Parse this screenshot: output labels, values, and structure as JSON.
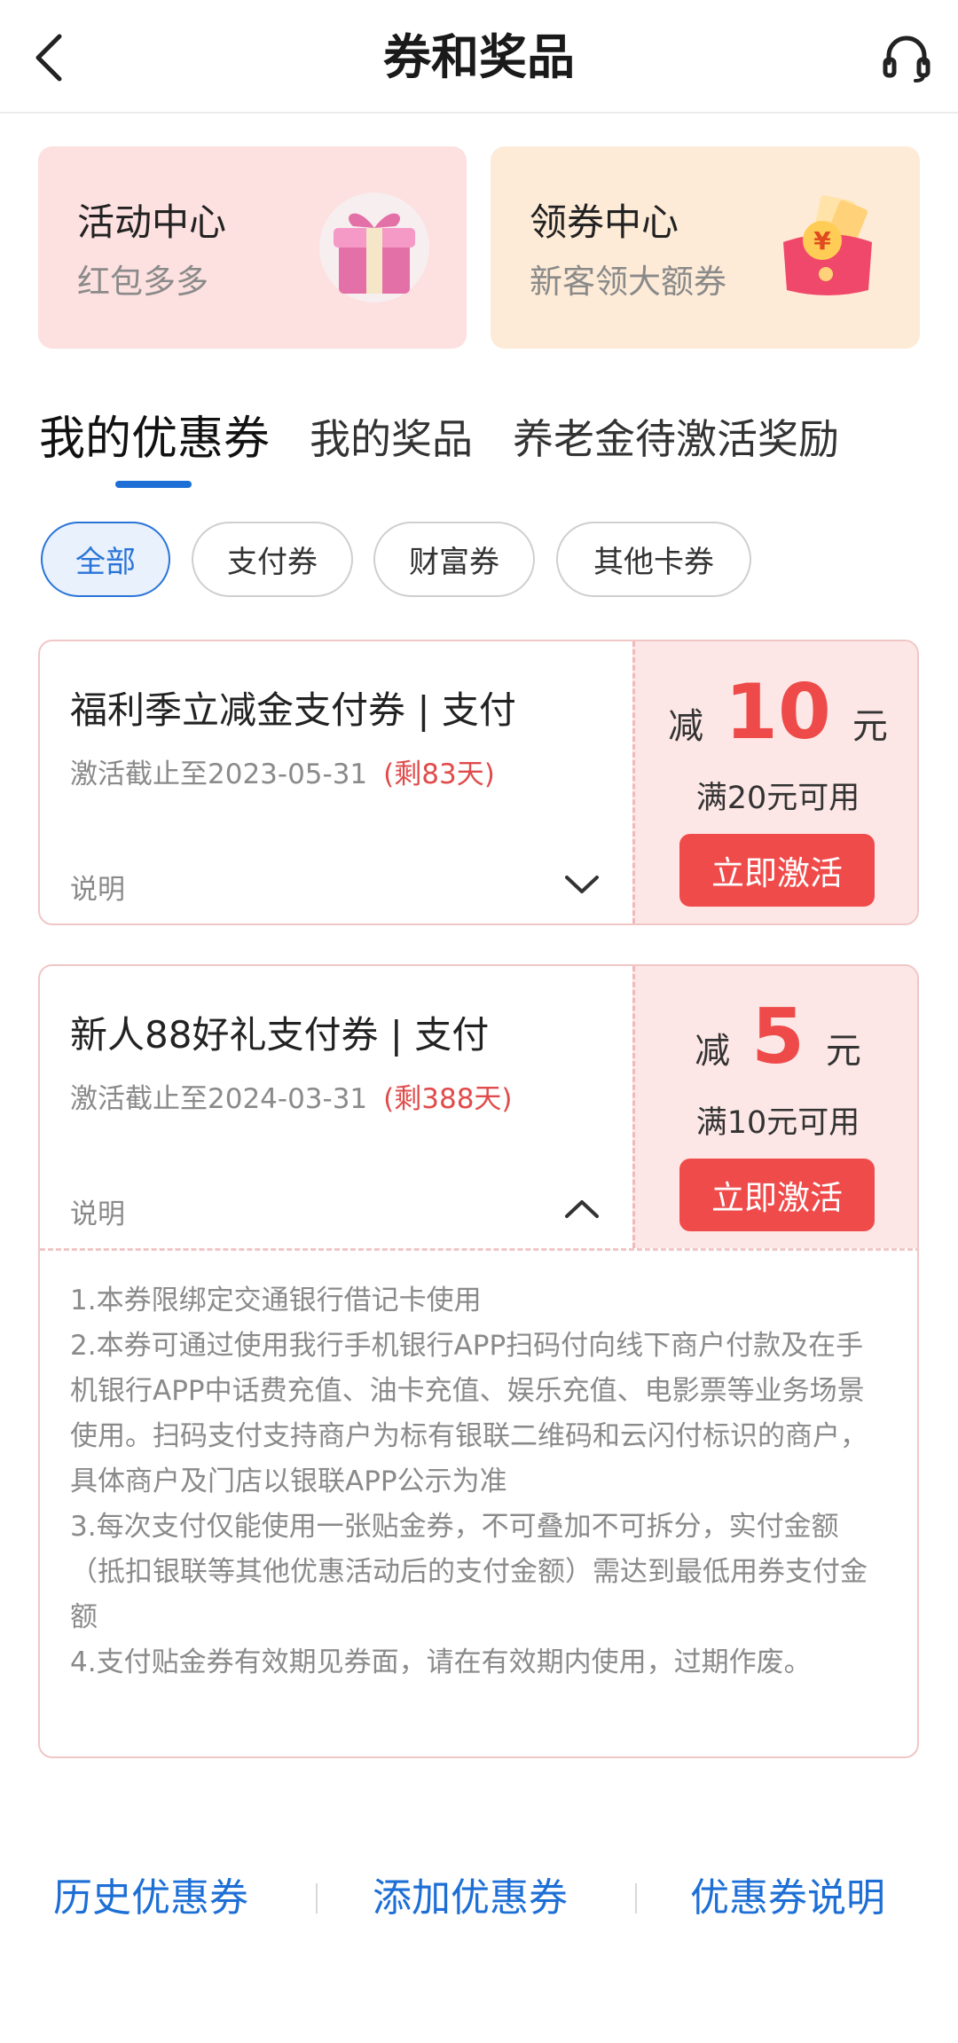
{
  "header": {
    "title": "券和奖品",
    "back_icon": "chevron-left-icon",
    "service_icon": "headset-icon"
  },
  "top_cards": [
    {
      "title": "活动中心",
      "subtitle": "红包多多",
      "icon": "gift-box-icon"
    },
    {
      "title": "领券中心",
      "subtitle": "新客领大额券",
      "icon": "red-envelope-icon"
    }
  ],
  "tabs": [
    {
      "label": "我的优惠券",
      "active": true
    },
    {
      "label": "我的奖品",
      "active": false
    },
    {
      "label": "养老金待激活奖励",
      "active": false
    }
  ],
  "filters": [
    {
      "label": "全部",
      "active": true
    },
    {
      "label": "支付券",
      "active": false
    },
    {
      "label": "财富券",
      "active": false
    },
    {
      "label": "其他卡券",
      "active": false
    }
  ],
  "coupons": [
    {
      "title": "福利季立减金支付券 | 支付",
      "deadline": "激活截止至2023-05-31",
      "remaining": "(剩83天)",
      "note_label": "说明",
      "prefix": "减",
      "amount": "10",
      "unit": "元",
      "condition": "满20元可用",
      "button": "立即激活",
      "expanded": false
    },
    {
      "title": "新人88好礼支付券 | 支付",
      "deadline": "激活截止至2024-03-31",
      "remaining": "(剩388天)",
      "note_label": "说明",
      "prefix": "减",
      "amount": "5",
      "unit": "元",
      "condition": "满10元可用",
      "button": "立即激活",
      "expanded": true,
      "description": [
        "1.本券限绑定交通银行借记卡使用",
        "2.本券可通过使用我行手机银行APP扫码付向线下商户付款及在手机银行APP中话费充值、油卡充值、娱乐充值、电影票等业务场景使用。扫码支付支持商户为标有银联二维码和云闪付标识的商户，具体商户及门店以银联APP公示为准",
        "3.每次支付仅能使用一张贴金券，不可叠加不可拆分，实付金额（抵扣银联等其他优惠活动后的支付金额）需达到最低用券支付金额",
        "4.支付贴金券有效期见券面，请在有效期内使用，过期作废。"
      ]
    }
  ],
  "footer": {
    "history": "历史优惠券",
    "add": "添加优惠券",
    "explain": "优惠券说明"
  },
  "colors": {
    "accent_blue": "#1d6fd6",
    "accent_red": "#f04b4b",
    "activity_bg": "#fde0e0",
    "coupon_bg": "#fdebd7"
  }
}
